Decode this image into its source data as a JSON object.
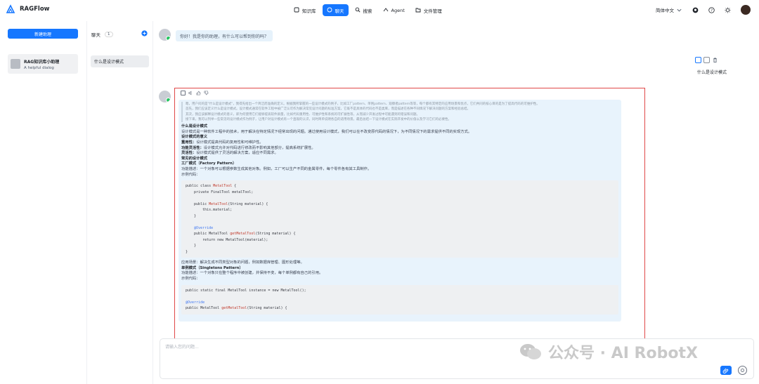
{
  "app": {
    "name": "RAGFlow"
  },
  "nav": [
    {
      "label": "知识库",
      "icon": "database-icon",
      "active": false
    },
    {
      "label": "聊天",
      "icon": "chat-icon",
      "active": true
    },
    {
      "label": "搜索",
      "icon": "search-icon",
      "active": false
    },
    {
      "label": "Agent",
      "icon": "agent-icon",
      "active": false
    },
    {
      "label": "文件管理",
      "icon": "folder-icon",
      "active": false
    }
  ],
  "header": {
    "language": "简体中文"
  },
  "sidebar": {
    "new_button": "新建助理",
    "assistant": {
      "name": "RAG知识库小助理",
      "description": "A helpful dialog"
    }
  },
  "conversations": {
    "title": "聊天",
    "count": "1",
    "items": [
      {
        "label": "什么是设计模式"
      }
    ]
  },
  "chat": {
    "greeting": "你好！我是你的助理，有什么可以帮到你的吗？",
    "user_message": "什么是设计模式",
    "answer": {
      "think": [
        "嗯，用户问的是\"什么是设计模式\"，我得先给出一个简洁而准确的定义。根据我所掌握的一些设计模式的例子，比如工厂pattern、单例pattern、观察者pattern等等，每个都有其特定的应用场景和优点，它们共同的核心目的是为了提高代码的可维护性。",
        "首先，我们应该定义什么是设计模式。设计模式通常在软件工程中被广泛认可作为解决常见设计问题的标准方案，它既不是具体的代码也不是类库，而是描述在各种不同情况下解决问题的方案和经验总结。",
        "其次，我应该解释设计模式的意义，即为何使用它们能够提高软件质量，比如代码重用性、可维护性和系统的可扩展性等，从而减少开发过程中可能遇到的错误和问题。",
        "接下来，我可以列举一些常见的设计模式作为例子，让用户对设计模式有一个直观的认识，同时简单说明各自的适用场景。最后总结一下设计模式在实际开发中的价值以及学习它们的必要性。"
      ],
      "sections": [
        {
          "kind": "heading",
          "text": "什么是设计模式"
        },
        {
          "kind": "text",
          "text": "设计模式是一种软件工程中的技术，用于解决在特定情况下经常出现的问题。通过使用设计模式，我们可以在不改变原代码的情况下，为不同情况下的需求提供不同的实现方式。"
        },
        {
          "kind": "heading",
          "text": "设计模式的意义"
        },
        {
          "kind": "item",
          "label": "重用性：",
          "text": "设计模式提高代码的复用性和可维护性。"
        },
        {
          "kind": "item",
          "label": "功能灵活性：",
          "text": "设计模式允许对代码进行修改而不影响其他部分，提高系统扩展性。"
        },
        {
          "kind": "item",
          "label": "灵活性：",
          "text": "设计模式提供了灵活的解决方案，适应不同需求。"
        },
        {
          "kind": "heading",
          "text": "常见的设计模式"
        },
        {
          "kind": "heading",
          "text": "工厂模式（Factory Pattern）"
        },
        {
          "kind": "text",
          "text": "功能描述：一个对象可以根据参数生成其他对象。例如，工厂可以生产不同的金属零件，每个零件各有其工具制作。"
        },
        {
          "kind": "text",
          "text": "示例代码："
        }
      ],
      "code1": [
        "public class MetalTool {",
        "    private FinalTool metalTool;",
        "",
        "    public MetalTool(String material) {",
        "        this.material;",
        "    }",
        "",
        "    @Override",
        "    public MetalTool getMetalTool(String material) {",
        "        return new MetalTool(material);",
        "    }",
        "}"
      ],
      "sections2": [
        {
          "kind": "text",
          "text": "应用场景：解决生成不同类型对象的问题，例如数据库管理、图形处理等。"
        },
        {
          "kind": "heading",
          "text": "单例模式（Singletons Pattern）"
        },
        {
          "kind": "text",
          "text": "功能描述：一个对象只在整个程序中被创建，并保持不变，每个单例都有自己的引用。"
        },
        {
          "kind": "text",
          "text": "示例代码："
        }
      ],
      "code2": [
        "public static final MetalTool instance = new MetalTool();",
        "",
        "@Override",
        "public MetalTool getMetalTool(String material) {"
      ]
    },
    "input_placeholder": "请输入您的问题..."
  },
  "watermark": "公众号 · AI RobotX",
  "colors": {
    "primary": "#1677ff",
    "answer_bg": "#e8f3fc",
    "highlight_border": "#e04848"
  }
}
